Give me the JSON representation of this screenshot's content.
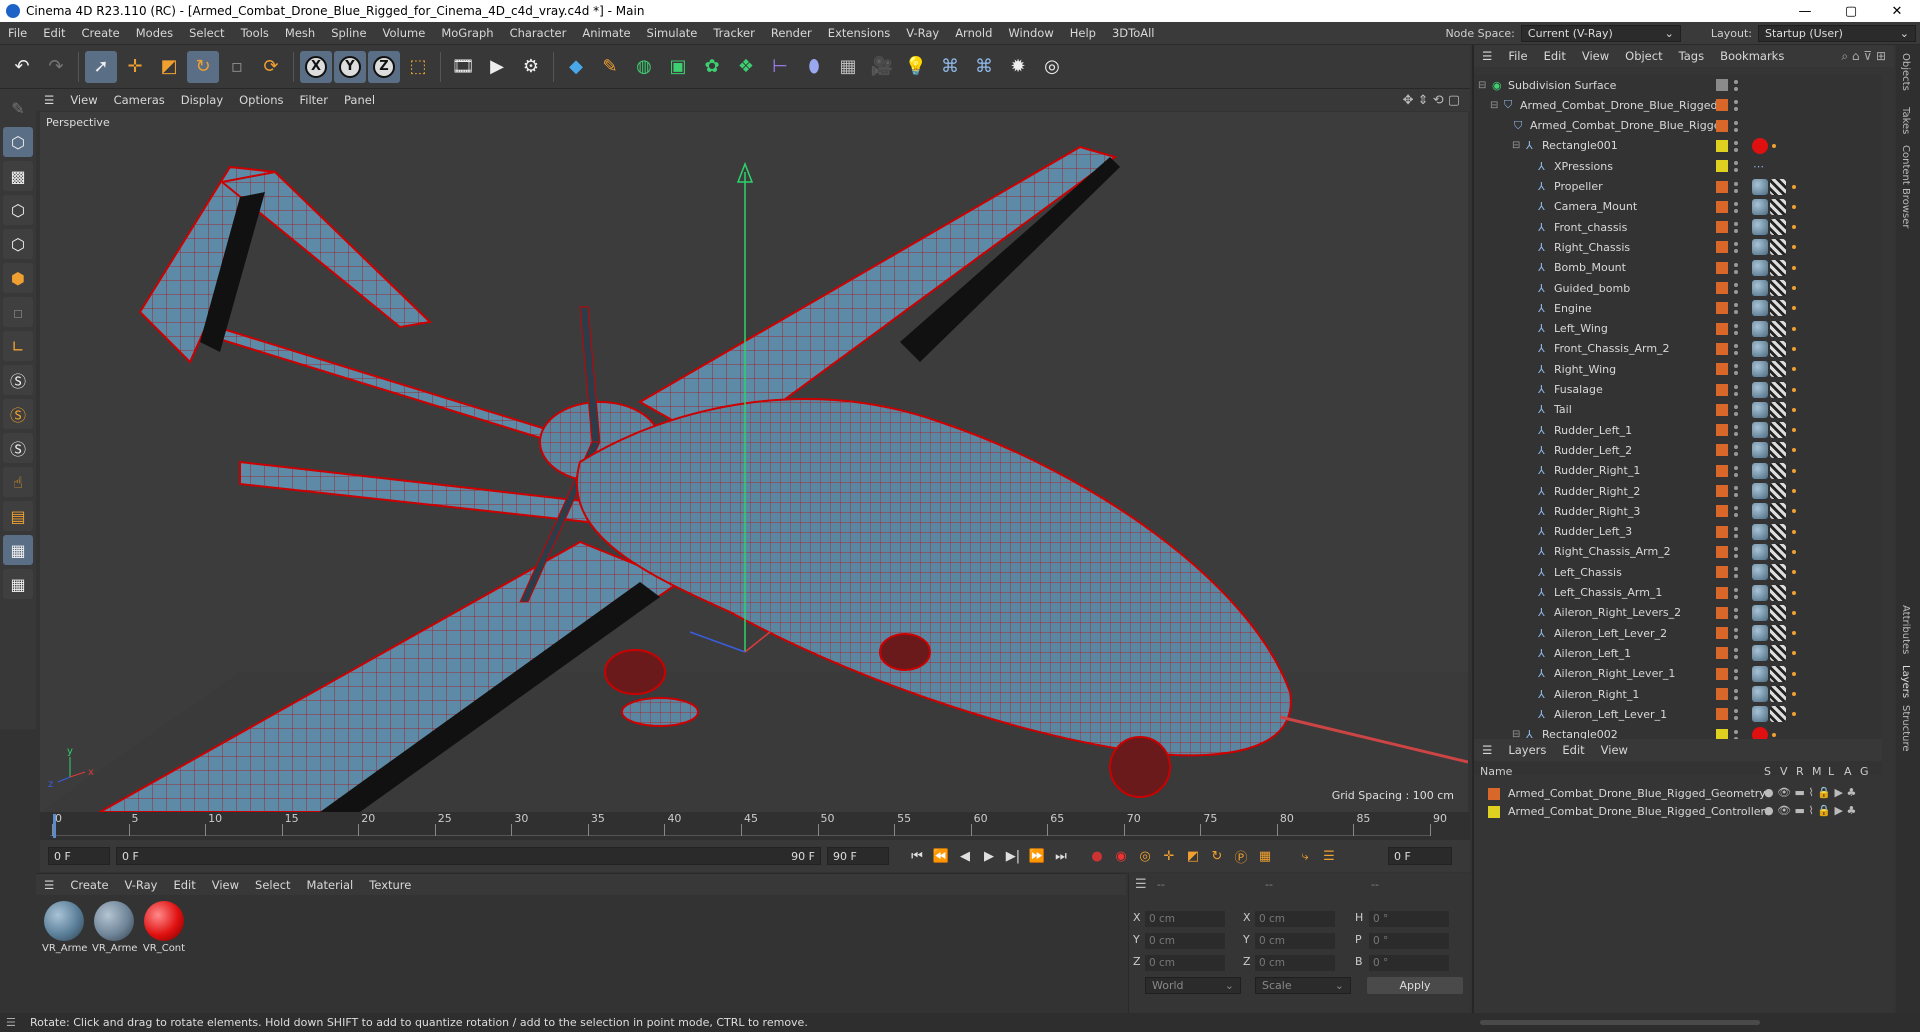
{
  "app": {
    "title": "Cinema 4D R23.110 (RC) - [Armed_Combat_Drone_Blue_Rigged_for_Cinema_4D_c4d_vray.c4d *] - Main",
    "window_controls": [
      "—",
      "▢",
      "✕"
    ]
  },
  "menu": {
    "items": [
      "File",
      "Edit",
      "Create",
      "Modes",
      "Select",
      "Tools",
      "Mesh",
      "Spline",
      "Volume",
      "MoGraph",
      "Character",
      "Animate",
      "Simulate",
      "Tracker",
      "Render",
      "Extensions",
      "V-Ray",
      "Arnold",
      "Window",
      "Help",
      "3DToAll"
    ],
    "node_space_label": "Node Space:",
    "node_space_value": "Current (V-Ray)",
    "layout_label": "Layout:",
    "layout_value": "Startup (User)"
  },
  "toolbar": {
    "icons": [
      "undo-icon",
      "redo-icon",
      "select-icon",
      "move-icon",
      "scale-icon",
      "rotate-icon",
      "recent-icon",
      "x-axis-icon",
      "y-axis-icon",
      "z-axis-icon",
      "coord-system-icon",
      "render-region-icon",
      "render-view-icon",
      "render-settings-icon",
      "cube-icon",
      "pen-icon",
      "subdivision-icon",
      "extrude-icon",
      "array-icon",
      "cloner-icon",
      "deformer-icon",
      "field-icon",
      "floor-icon",
      "camera-icon",
      "light-icon",
      "python-icon",
      "python2-icon",
      "settings-icon",
      "globe-icon"
    ],
    "axis_labels": [
      "X",
      "Y",
      "Z"
    ]
  },
  "viewport": {
    "menu": [
      "View",
      "Cameras",
      "Display",
      "Options",
      "Filter",
      "Panel"
    ],
    "label": "Perspective",
    "grid_spacing": "Grid Spacing : 100 cm",
    "axis_y": "y",
    "axis_x": "x",
    "axis_z": "z"
  },
  "timeline": {
    "ticks": [
      "0",
      "5",
      "10",
      "15",
      "20",
      "25",
      "30",
      "35",
      "40",
      "45",
      "50",
      "55",
      "60",
      "65",
      "70",
      "75",
      "80",
      "85",
      "90"
    ],
    "current_frame": "0 F",
    "start_frame": "0 F",
    "slider_start": "0 F",
    "slider_end": "90 F",
    "end_frame": "90 F",
    "frame_display": "0 F"
  },
  "materials": {
    "menu": [
      "Create",
      "V-Ray",
      "Edit",
      "View",
      "Select",
      "Material",
      "Texture"
    ],
    "items": [
      {
        "label": "VR_Arme",
        "color": "#5b7f99"
      },
      {
        "label": "VR_Arme",
        "color": "#6f8598"
      },
      {
        "label": "VR_Cont",
        "color": "#e01010"
      }
    ]
  },
  "coords": {
    "headers": [
      "--",
      "--",
      "--"
    ],
    "rows": [
      {
        "a_lab": "X",
        "a": "0 cm",
        "b_lab": "X",
        "b": "0 cm",
        "c_lab": "H",
        "c": "0 °"
      },
      {
        "a_lab": "Y",
        "a": "0 cm",
        "b_lab": "Y",
        "b": "0 cm",
        "c_lab": "P",
        "c": "0 °"
      },
      {
        "a_lab": "Z",
        "a": "0 cm",
        "b_lab": "Z",
        "b": "0 cm",
        "c_lab": "B",
        "c": "0 °"
      }
    ],
    "world": "World",
    "scale": "Scale",
    "apply": "Apply"
  },
  "status": "Rotate: Click and drag to rotate elements. Hold down SHIFT to add to quantize rotation / add to the selection in point mode, CTRL to remove.",
  "objects": {
    "menu": [
      "File",
      "Edit",
      "View",
      "Object",
      "Tags",
      "Bookmarks"
    ],
    "rows": [
      {
        "name": "Subdivision Surface",
        "indent": 0,
        "color": "#8a8a8a",
        "tag": "none"
      },
      {
        "name": "Armed_Combat_Drone_Blue_Rigged",
        "indent": 1,
        "color": "#d9672a",
        "tag": "none"
      },
      {
        "name": "Armed_Combat_Drone_Blue_Rigged",
        "indent": 2,
        "color": "#d9672a",
        "tag": "none"
      },
      {
        "name": "Rectangle001",
        "indent": 3,
        "color": "#e0d020",
        "tag": "red"
      },
      {
        "name": "XPressions",
        "indent": 4,
        "color": "#e0d020",
        "tag": "xp"
      },
      {
        "name": "Propeller",
        "indent": 4,
        "color": "#d9672a",
        "tag": "mat"
      },
      {
        "name": "Camera_Mount",
        "indent": 4,
        "color": "#d9672a",
        "tag": "mat"
      },
      {
        "name": "Front_chassis",
        "indent": 4,
        "color": "#d9672a",
        "tag": "mat"
      },
      {
        "name": "Right_Chassis",
        "indent": 4,
        "color": "#d9672a",
        "tag": "mat"
      },
      {
        "name": "Bomb_Mount",
        "indent": 4,
        "color": "#d9672a",
        "tag": "mat"
      },
      {
        "name": "Guided_bomb",
        "indent": 4,
        "color": "#d9672a",
        "tag": "mat"
      },
      {
        "name": "Engine",
        "indent": 4,
        "color": "#d9672a",
        "tag": "mat"
      },
      {
        "name": "Left_Wing",
        "indent": 4,
        "color": "#d9672a",
        "tag": "mat"
      },
      {
        "name": "Front_Chassis_Arm_2",
        "indent": 4,
        "color": "#d9672a",
        "tag": "mat"
      },
      {
        "name": "Right_Wing",
        "indent": 4,
        "color": "#d9672a",
        "tag": "mat"
      },
      {
        "name": "Fusalage",
        "indent": 4,
        "color": "#d9672a",
        "tag": "mat"
      },
      {
        "name": "Tail",
        "indent": 4,
        "color": "#d9672a",
        "tag": "mat"
      },
      {
        "name": "Rudder_Left_1",
        "indent": 4,
        "color": "#d9672a",
        "tag": "mat"
      },
      {
        "name": "Rudder_Left_2",
        "indent": 4,
        "color": "#d9672a",
        "tag": "mat"
      },
      {
        "name": "Rudder_Right_1",
        "indent": 4,
        "color": "#d9672a",
        "tag": "mat"
      },
      {
        "name": "Rudder_Right_2",
        "indent": 4,
        "color": "#d9672a",
        "tag": "mat"
      },
      {
        "name": "Rudder_Right_3",
        "indent": 4,
        "color": "#d9672a",
        "tag": "mat"
      },
      {
        "name": "Rudder_Left_3",
        "indent": 4,
        "color": "#d9672a",
        "tag": "mat"
      },
      {
        "name": "Right_Chassis_Arm_2",
        "indent": 4,
        "color": "#d9672a",
        "tag": "mat"
      },
      {
        "name": "Left_Chassis",
        "indent": 4,
        "color": "#d9672a",
        "tag": "mat"
      },
      {
        "name": "Left_Chassis_Arm_1",
        "indent": 4,
        "color": "#d9672a",
        "tag": "mat"
      },
      {
        "name": "Aileron_Right_Levers_2",
        "indent": 4,
        "color": "#d9672a",
        "tag": "mat"
      },
      {
        "name": "Aileron_Left_Lever_2",
        "indent": 4,
        "color": "#d9672a",
        "tag": "mat"
      },
      {
        "name": "Aileron_Left_1",
        "indent": 4,
        "color": "#d9672a",
        "tag": "mat"
      },
      {
        "name": "Aileron_Right_Lever_1",
        "indent": 4,
        "color": "#d9672a",
        "tag": "mat"
      },
      {
        "name": "Aileron_Right_1",
        "indent": 4,
        "color": "#d9672a",
        "tag": "mat"
      },
      {
        "name": "Aileron_Left_Lever_1",
        "indent": 4,
        "color": "#d9672a",
        "tag": "mat"
      },
      {
        "name": "Rectangle002",
        "indent": 3,
        "color": "#e0d020",
        "tag": "red"
      }
    ]
  },
  "layers": {
    "menu": [
      "Layers",
      "Edit",
      "View"
    ],
    "col_name": "Name",
    "cols": [
      "S",
      "V",
      "R",
      "M",
      "L",
      "A",
      "G"
    ],
    "rows": [
      {
        "name": "Armed_Combat_Drone_Blue_Rigged_Geometry",
        "color": "#d9672a"
      },
      {
        "name": "Armed_Combat_Drone_Blue_Rigged_Controllers",
        "color": "#e0d020"
      }
    ]
  },
  "side_tabs": [
    "Objects",
    "Takes",
    "Content Browser",
    "Attributes",
    "Layers",
    "Structure"
  ]
}
